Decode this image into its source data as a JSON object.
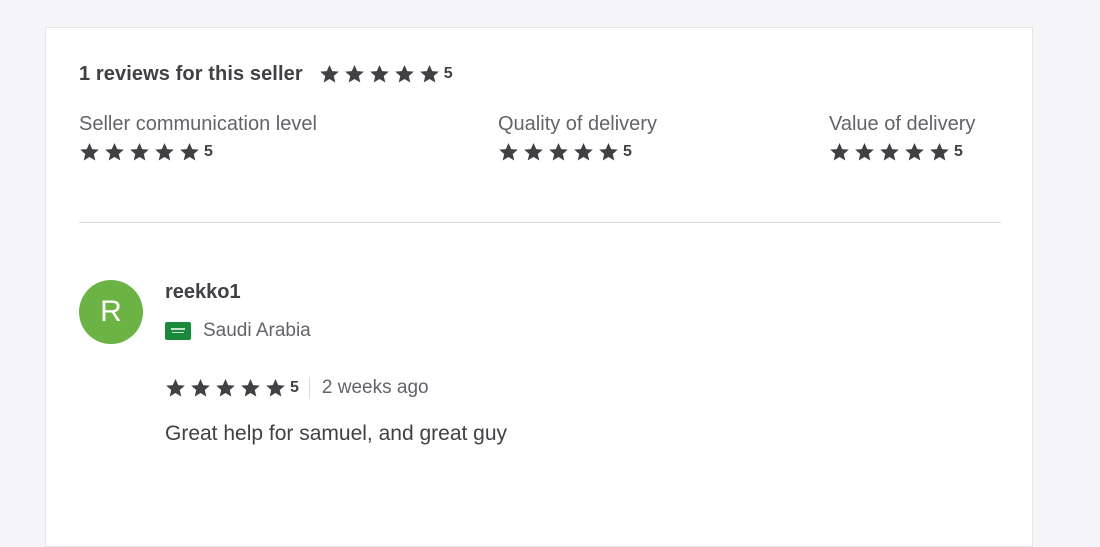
{
  "summary": {
    "title": "1 reviews for this seller",
    "rating": "5",
    "stars": 5
  },
  "breakdown": [
    {
      "label": "Seller communication level",
      "rating": "5",
      "stars": 5
    },
    {
      "label": "Quality of delivery",
      "rating": "5",
      "stars": 5
    },
    {
      "label": "Value of delivery",
      "rating": "5",
      "stars": 5
    }
  ],
  "review": {
    "avatar_initial": "R",
    "avatar_color": "#6bb344",
    "username": "reekko1",
    "country": "Saudi Arabia",
    "flag_icon": "saudi-arabia-flag-icon",
    "rating": "5",
    "stars": 5,
    "time": "2 weeks ago",
    "text": "Great help for samuel, and great guy"
  },
  "colors": {
    "star": "#404145",
    "text_primary": "#404145",
    "text_secondary": "#62646a"
  }
}
